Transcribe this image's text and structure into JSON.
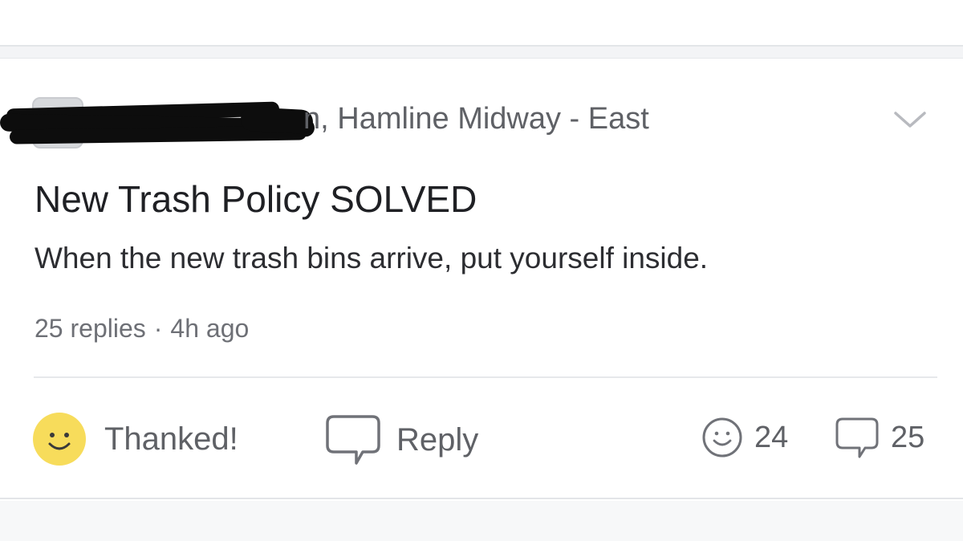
{
  "post": {
    "author_location": "n, Hamline Midway - East",
    "title": "New Trash Policy SOLVED",
    "body": "When the new trash bins arrive, put yourself inside.",
    "meta": {
      "replies": "25 replies",
      "separator": "·",
      "time": "4h ago"
    }
  },
  "actions": {
    "thank_label": "Thanked!",
    "reply_label": "Reply"
  },
  "stats": {
    "thanks_count": "24",
    "replies_count": "25"
  },
  "icons": {
    "expand": "chevron-down-icon",
    "thanked": "smiley-filled-icon",
    "reply": "speech-bubble-icon",
    "thanks_count": "smiley-outline-icon",
    "replies_count": "speech-bubble-small-icon"
  },
  "colors": {
    "thanked_yellow": "#f7dc5b",
    "text_primary": "#1f2024",
    "text_secondary": "#5f6166",
    "icon_gray": "#707278",
    "divider": "#e6e8eb",
    "redaction": "#0d0d0d"
  }
}
